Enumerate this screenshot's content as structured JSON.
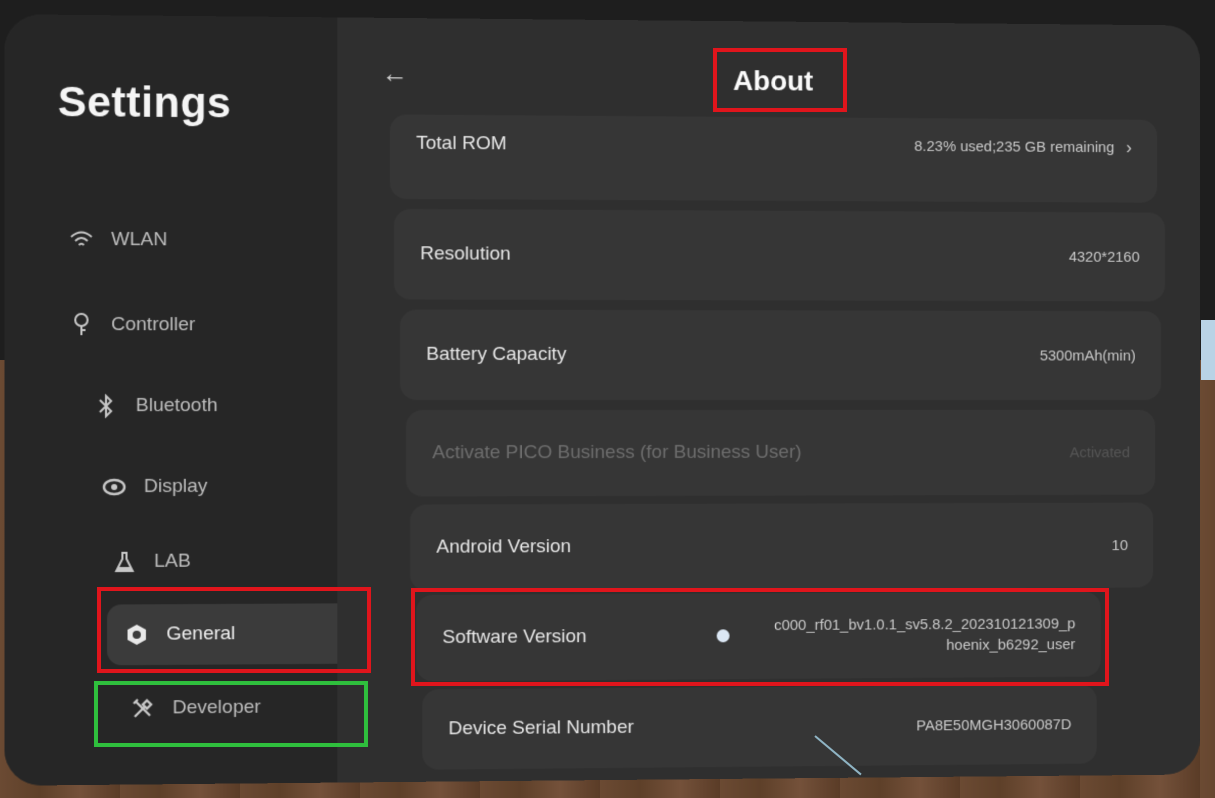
{
  "sidebar": {
    "title": "Settings",
    "items": [
      {
        "label": "WLAN",
        "icon": "wifi-icon"
      },
      {
        "label": "Controller",
        "icon": "controller-icon"
      },
      {
        "label": "Bluetooth",
        "icon": "bluetooth-icon"
      },
      {
        "label": "Display",
        "icon": "eye-icon"
      },
      {
        "label": "LAB",
        "icon": "flask-icon"
      },
      {
        "label": "General",
        "icon": "gear-icon"
      },
      {
        "label": "Developer",
        "icon": "tools-icon"
      }
    ]
  },
  "header": {
    "back": "←",
    "title": "About"
  },
  "rows": [
    {
      "label": "Total ROM",
      "value": "8.23% used;235 GB remaining"
    },
    {
      "label": "Resolution",
      "value": "4320*2160"
    },
    {
      "label": "Battery Capacity",
      "value": "5300mAh(min)"
    },
    {
      "label": "Activate PICO Business (for Business User)",
      "value": "Activated"
    },
    {
      "label": "Android Version",
      "value": "10"
    },
    {
      "label": "Software Version",
      "value_line1": "c000_rf01_bv1.0.1_sv5.8.2_202310121309_p",
      "value_line2": "hoenix_b6292_user"
    },
    {
      "label": "Device Serial Number",
      "value": "PA8E50MGH3060087D"
    }
  ],
  "colors": {
    "highlight_red": "#e0151c",
    "highlight_green": "#2fbf3d"
  }
}
